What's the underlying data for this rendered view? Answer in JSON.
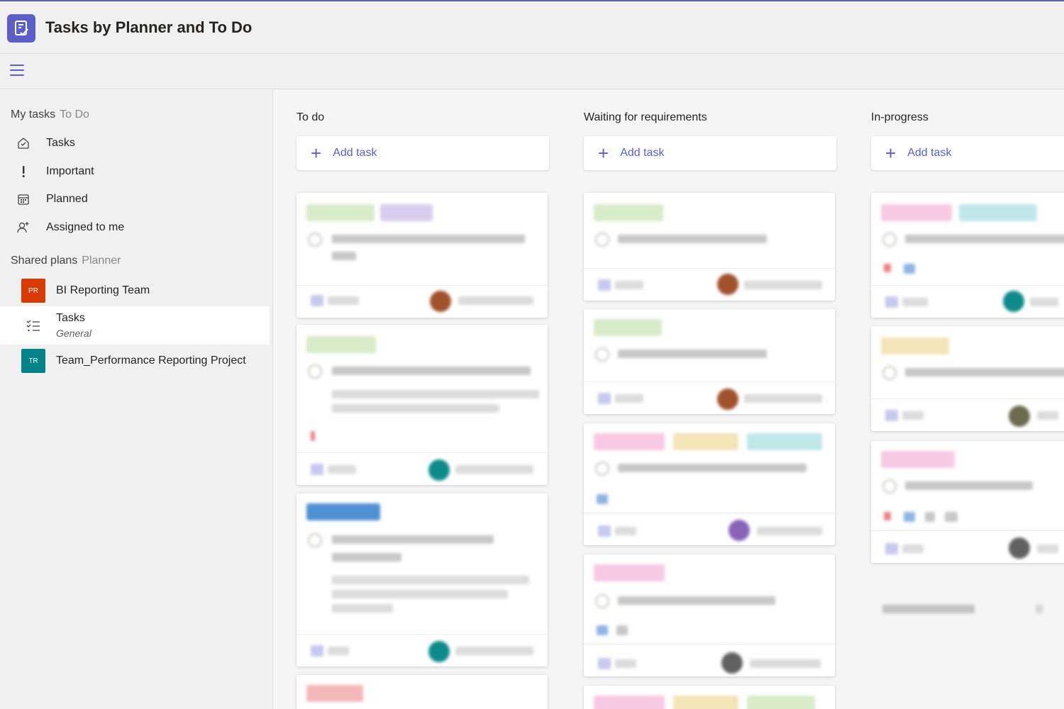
{
  "app": {
    "title": "Tasks by Planner and To Do"
  },
  "sidebar": {
    "my_tasks": {
      "label": "My tasks",
      "sub": "To Do"
    },
    "items": [
      {
        "label": "Tasks",
        "icon": "home-check-icon"
      },
      {
        "label": "Important",
        "icon": "exclamation-icon"
      },
      {
        "label": "Planned",
        "icon": "calendar-icon"
      },
      {
        "label": "Assigned to me",
        "icon": "person-add-icon"
      }
    ],
    "shared_plans": {
      "label": "Shared plans",
      "sub": "Planner"
    },
    "plans": [
      {
        "initials": "PR",
        "label": "BI Reporting Team",
        "color": "#d83b01"
      },
      {
        "label": "Tasks",
        "sub": "General",
        "icon": "list-check-icon",
        "selected": true
      },
      {
        "initials": "TR",
        "label": "Team_Performance Reporting Project",
        "color": "#038387"
      }
    ]
  },
  "board": {
    "add_task_label": "Add task",
    "columns": [
      {
        "title": "To do"
      },
      {
        "title": "Waiting for requirements"
      },
      {
        "title": "In-progress"
      }
    ]
  },
  "colors": {
    "accent": "#5b5fc7",
    "tag_green": "#d7ecc9",
    "tag_purple": "#d9cdef",
    "tag_blue": "#4f8fd3",
    "tag_pink": "#f7c9e3",
    "tag_yellow": "#f3e5b7",
    "tag_teal": "#bfe7ea",
    "tag_red": "#f3b8b8"
  }
}
